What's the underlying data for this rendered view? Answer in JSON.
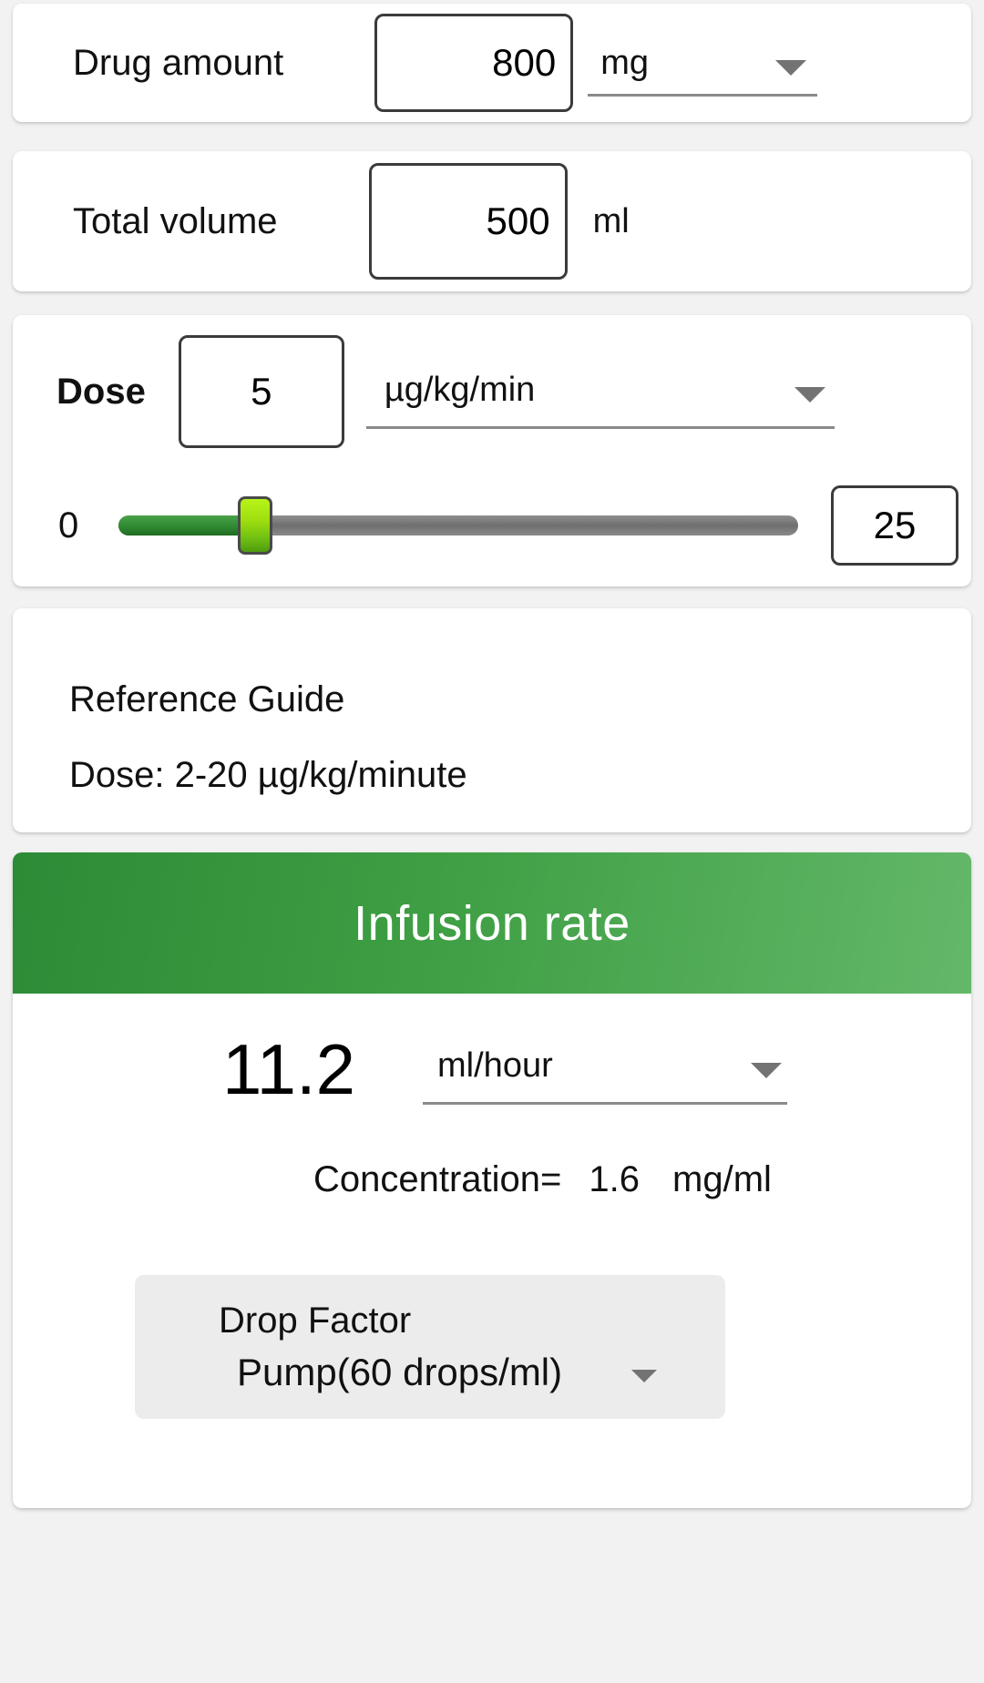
{
  "drug_amount": {
    "label": "Drug amount",
    "value": "800",
    "unit": "mg",
    "caret": "chevron-down-icon"
  },
  "total_volume": {
    "label": "Total volume",
    "value": "500",
    "unit": "ml"
  },
  "dose": {
    "label": "Dose",
    "value": "5",
    "unit": "µg/kg/min",
    "slider": {
      "min_label": "0",
      "max_label": "25",
      "min": 0,
      "max": 25,
      "current": 5,
      "fill_percent": 20,
      "fill_color": "#2f8a32",
      "thumb_color": "#9ede0e",
      "track_color": "#7a7a7a"
    }
  },
  "reference_guide": {
    "title": "Reference Guide",
    "line": "Dose: 2-20 µg/kg/minute"
  },
  "result": {
    "header_title": "Infusion rate",
    "header_color_start": "#2c8b36",
    "header_color_end": "#63b869",
    "value": "11.2",
    "unit": "ml/hour",
    "concentration_label": "Concentration=",
    "concentration_value": "1.6",
    "concentration_unit": "mg/ml",
    "drop_factor_title": "Drop Factor",
    "drop_factor_value": "Pump(60 drops/ml)"
  }
}
